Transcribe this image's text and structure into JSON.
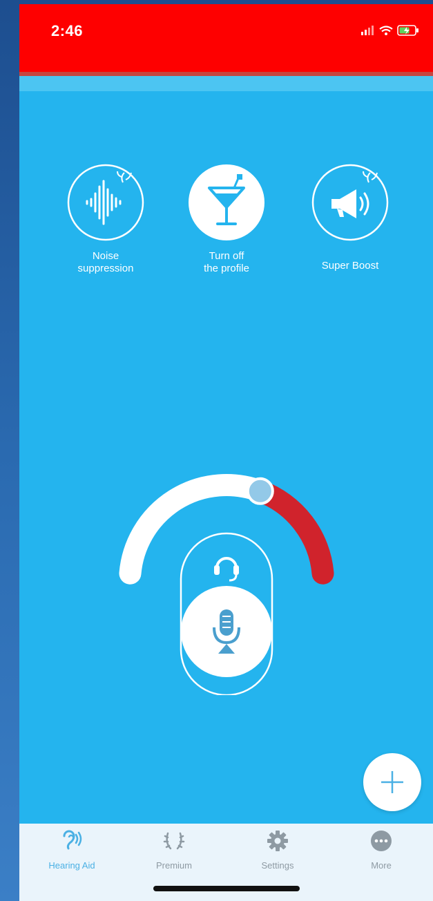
{
  "status_bar": {
    "time": "2:46"
  },
  "profiles": [
    {
      "label": "Noise\nsuppression",
      "icon": "soundwave-icon",
      "selected": false
    },
    {
      "label": "Turn off\nthe profile",
      "icon": "cocktail-glass-icon",
      "selected": true
    },
    {
      "label": "Super Boost",
      "icon": "megaphone-icon",
      "selected": false
    }
  ],
  "volume": {
    "level": 0.62
  },
  "input_modes": [
    {
      "name": "headset",
      "icon": "headset-icon",
      "selected": false
    },
    {
      "name": "microphone",
      "icon": "microphone-icon",
      "selected": true
    }
  ],
  "tabs": [
    {
      "label": "Hearing Aid",
      "icon": "ear-icon",
      "active": true
    },
    {
      "label": "Premium",
      "icon": "laurel-icon",
      "active": false
    },
    {
      "label": "Settings",
      "icon": "gear-icon",
      "active": false
    },
    {
      "label": "More",
      "icon": "ellipsis-icon",
      "active": false
    }
  ],
  "colors": {
    "status_bar": "#fe0000",
    "background": "#24b4ee",
    "volume_track": "#ffffff",
    "volume_high": "#d0232c",
    "active_tab": "#4ab0e4",
    "inactive_tab": "#8e9aa3"
  }
}
